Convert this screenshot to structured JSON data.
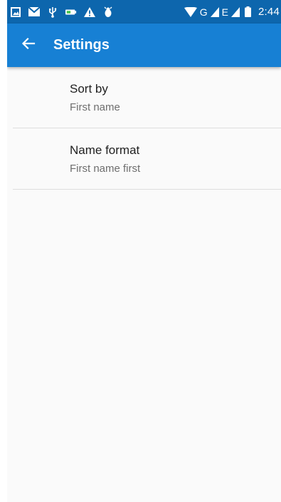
{
  "status_bar": {
    "time": "2:44",
    "network_g": "G",
    "network_e": "E",
    "left_icons": [
      "image-icon",
      "mail-icon",
      "usb-icon",
      "battery-saver-icon",
      "warning-icon",
      "android-debug-icon"
    ],
    "right_icons": [
      "wifi-icon",
      "signal-icon",
      "battery-icon"
    ]
  },
  "app_bar": {
    "title": "Settings",
    "back_icon": "arrow-back-icon",
    "background_color": "#1780d4",
    "status_color": "#0d66ad"
  },
  "settings": {
    "items": [
      {
        "title": "Sort by",
        "summary": "First name"
      },
      {
        "title": "Name format",
        "summary": "First name first"
      }
    ]
  }
}
